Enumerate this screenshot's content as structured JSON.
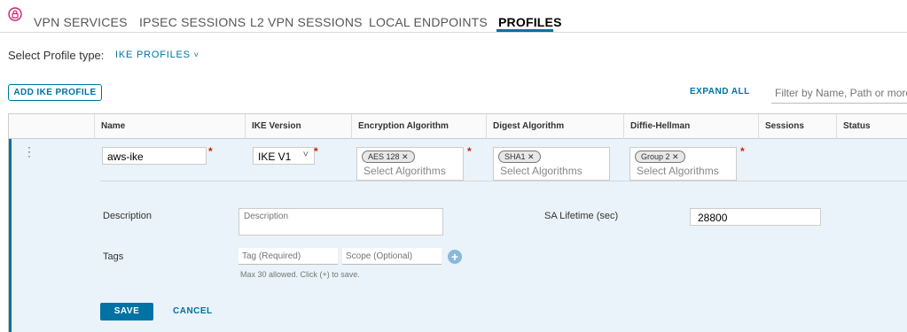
{
  "nav": {
    "tabs": [
      {
        "label": "VPN SERVICES",
        "active": false
      },
      {
        "label": "IPSEC SESSIONS",
        "active": false
      },
      {
        "label": "L2 VPN SESSIONS",
        "active": false
      },
      {
        "label": "LOCAL ENDPOINTS",
        "active": false
      },
      {
        "label": "PROFILES",
        "active": true
      }
    ],
    "accent": "#0072a3"
  },
  "profile_type": {
    "label": "Select Profile type:",
    "value": "IKE PROFILES",
    "chevron": "˅"
  },
  "toolbar": {
    "add_label": "ADD IKE PROFILE",
    "expand_all": "EXPAND ALL",
    "filter_placeholder": "Filter by Name, Path or more"
  },
  "grid": {
    "columns": [
      "Name",
      "IKE Version",
      "Encryption Algorithm",
      "Digest Algorithm",
      "Diffie-Hellman",
      "Sessions",
      "Status"
    ],
    "row": {
      "kebab": "⋮",
      "name": "aws-ike",
      "ike_version": "IKE V1",
      "ike_chevron": "˅",
      "encryption_chip": "AES 128 ✕",
      "digest_chip": "SHA1 ✕",
      "dh_chip": "Group 2 ✕",
      "select_placeholder": "Select Algorithms",
      "required": "*"
    },
    "details": {
      "description_label": "Description",
      "description_placeholder": "Description",
      "sa_lifetime_label": "SA Lifetime (sec)",
      "sa_lifetime_value": "28800",
      "tags_label": "Tags",
      "tag_placeholder": "Tag (Required)",
      "scope_placeholder": "Scope (Optional)",
      "add_icon": "+",
      "tags_hint": "Max 30 allowed. Click (+) to save."
    },
    "actions": {
      "save": "SAVE",
      "cancel": "CANCEL"
    }
  }
}
